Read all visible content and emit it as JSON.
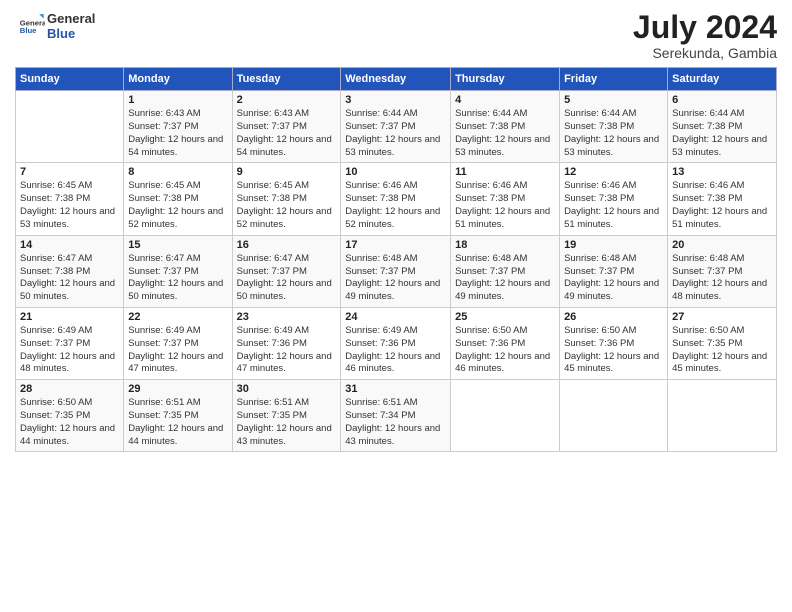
{
  "header": {
    "logo_general": "General",
    "logo_blue": "Blue",
    "month_year": "July 2024",
    "location": "Serekunda, Gambia"
  },
  "weekdays": [
    "Sunday",
    "Monday",
    "Tuesday",
    "Wednesday",
    "Thursday",
    "Friday",
    "Saturday"
  ],
  "weeks": [
    [
      {
        "day": "",
        "sunrise": "",
        "sunset": "",
        "daylight": ""
      },
      {
        "day": "1",
        "sunrise": "6:43 AM",
        "sunset": "7:37 PM",
        "daylight": "12 hours and 54 minutes."
      },
      {
        "day": "2",
        "sunrise": "6:43 AM",
        "sunset": "7:37 PM",
        "daylight": "12 hours and 54 minutes."
      },
      {
        "day": "3",
        "sunrise": "6:44 AM",
        "sunset": "7:37 PM",
        "daylight": "12 hours and 53 minutes."
      },
      {
        "day": "4",
        "sunrise": "6:44 AM",
        "sunset": "7:38 PM",
        "daylight": "12 hours and 53 minutes."
      },
      {
        "day": "5",
        "sunrise": "6:44 AM",
        "sunset": "7:38 PM",
        "daylight": "12 hours and 53 minutes."
      },
      {
        "day": "6",
        "sunrise": "6:44 AM",
        "sunset": "7:38 PM",
        "daylight": "12 hours and 53 minutes."
      }
    ],
    [
      {
        "day": "7",
        "sunrise": "6:45 AM",
        "sunset": "7:38 PM",
        "daylight": "12 hours and 53 minutes."
      },
      {
        "day": "8",
        "sunrise": "6:45 AM",
        "sunset": "7:38 PM",
        "daylight": "12 hours and 52 minutes."
      },
      {
        "day": "9",
        "sunrise": "6:45 AM",
        "sunset": "7:38 PM",
        "daylight": "12 hours and 52 minutes."
      },
      {
        "day": "10",
        "sunrise": "6:46 AM",
        "sunset": "7:38 PM",
        "daylight": "12 hours and 52 minutes."
      },
      {
        "day": "11",
        "sunrise": "6:46 AM",
        "sunset": "7:38 PM",
        "daylight": "12 hours and 51 minutes."
      },
      {
        "day": "12",
        "sunrise": "6:46 AM",
        "sunset": "7:38 PM",
        "daylight": "12 hours and 51 minutes."
      },
      {
        "day": "13",
        "sunrise": "6:46 AM",
        "sunset": "7:38 PM",
        "daylight": "12 hours and 51 minutes."
      }
    ],
    [
      {
        "day": "14",
        "sunrise": "6:47 AM",
        "sunset": "7:38 PM",
        "daylight": "12 hours and 50 minutes."
      },
      {
        "day": "15",
        "sunrise": "6:47 AM",
        "sunset": "7:37 PM",
        "daylight": "12 hours and 50 minutes."
      },
      {
        "day": "16",
        "sunrise": "6:47 AM",
        "sunset": "7:37 PM",
        "daylight": "12 hours and 50 minutes."
      },
      {
        "day": "17",
        "sunrise": "6:48 AM",
        "sunset": "7:37 PM",
        "daylight": "12 hours and 49 minutes."
      },
      {
        "day": "18",
        "sunrise": "6:48 AM",
        "sunset": "7:37 PM",
        "daylight": "12 hours and 49 minutes."
      },
      {
        "day": "19",
        "sunrise": "6:48 AM",
        "sunset": "7:37 PM",
        "daylight": "12 hours and 49 minutes."
      },
      {
        "day": "20",
        "sunrise": "6:48 AM",
        "sunset": "7:37 PM",
        "daylight": "12 hours and 48 minutes."
      }
    ],
    [
      {
        "day": "21",
        "sunrise": "6:49 AM",
        "sunset": "7:37 PM",
        "daylight": "12 hours and 48 minutes."
      },
      {
        "day": "22",
        "sunrise": "6:49 AM",
        "sunset": "7:37 PM",
        "daylight": "12 hours and 47 minutes."
      },
      {
        "day": "23",
        "sunrise": "6:49 AM",
        "sunset": "7:36 PM",
        "daylight": "12 hours and 47 minutes."
      },
      {
        "day": "24",
        "sunrise": "6:49 AM",
        "sunset": "7:36 PM",
        "daylight": "12 hours and 46 minutes."
      },
      {
        "day": "25",
        "sunrise": "6:50 AM",
        "sunset": "7:36 PM",
        "daylight": "12 hours and 46 minutes."
      },
      {
        "day": "26",
        "sunrise": "6:50 AM",
        "sunset": "7:36 PM",
        "daylight": "12 hours and 45 minutes."
      },
      {
        "day": "27",
        "sunrise": "6:50 AM",
        "sunset": "7:35 PM",
        "daylight": "12 hours and 45 minutes."
      }
    ],
    [
      {
        "day": "28",
        "sunrise": "6:50 AM",
        "sunset": "7:35 PM",
        "daylight": "12 hours and 44 minutes."
      },
      {
        "day": "29",
        "sunrise": "6:51 AM",
        "sunset": "7:35 PM",
        "daylight": "12 hours and 44 minutes."
      },
      {
        "day": "30",
        "sunrise": "6:51 AM",
        "sunset": "7:35 PM",
        "daylight": "12 hours and 43 minutes."
      },
      {
        "day": "31",
        "sunrise": "6:51 AM",
        "sunset": "7:34 PM",
        "daylight": "12 hours and 43 minutes."
      },
      {
        "day": "",
        "sunrise": "",
        "sunset": "",
        "daylight": ""
      },
      {
        "day": "",
        "sunrise": "",
        "sunset": "",
        "daylight": ""
      },
      {
        "day": "",
        "sunrise": "",
        "sunset": "",
        "daylight": ""
      }
    ]
  ]
}
